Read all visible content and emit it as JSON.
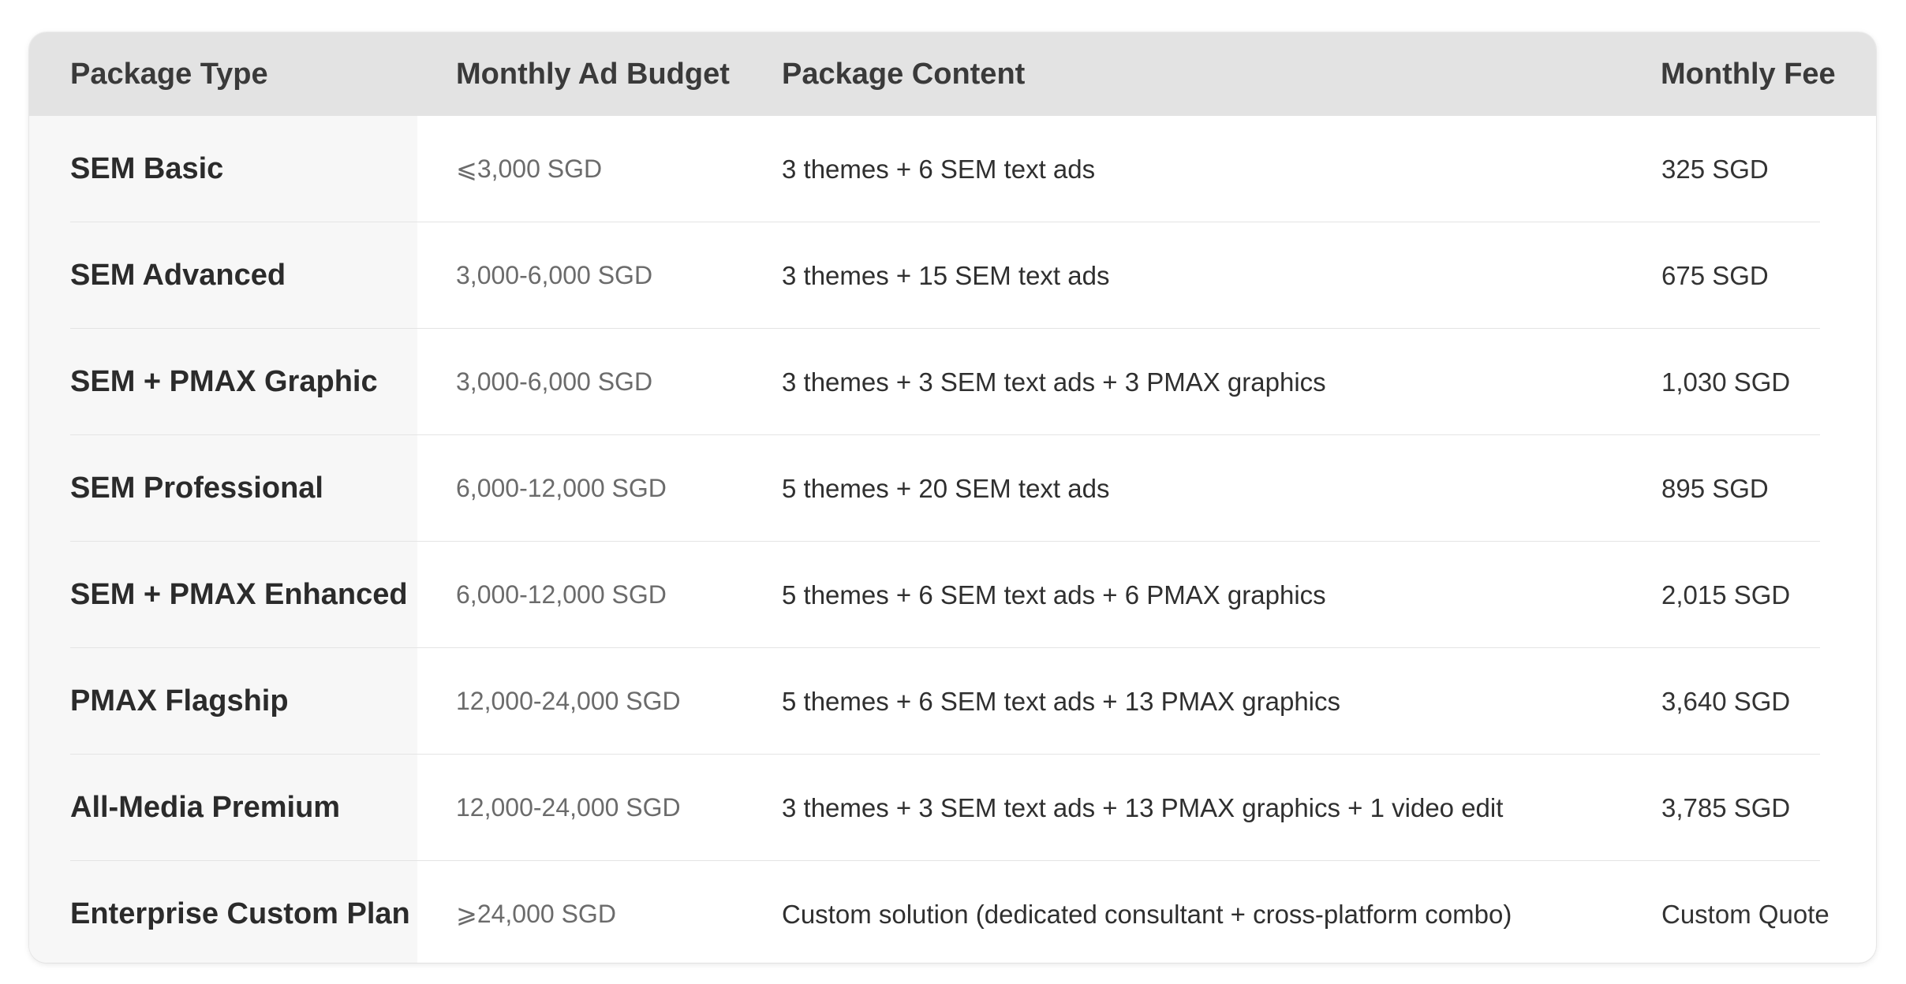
{
  "table": {
    "headers": {
      "package_type": "Package Type",
      "monthly_ad_budget": "Monthly Ad Budget",
      "package_content": "Package Content",
      "monthly_fee": "Monthly Fee"
    },
    "rows": [
      {
        "type": "SEM Basic",
        "budget": "⩽3,000 SGD",
        "content": "3 themes + 6 SEM text ads",
        "fee": "325 SGD"
      },
      {
        "type": "SEM Advanced",
        "budget": "3,000-6,000 SGD",
        "content": "3 themes + 15 SEM text ads",
        "fee": "675 SGD"
      },
      {
        "type": "SEM + PMAX Graphic",
        "budget": "3,000-6,000 SGD",
        "content": "3 themes + 3 SEM text ads + 3 PMAX graphics",
        "fee": "1,030 SGD"
      },
      {
        "type": "SEM Professional",
        "budget": "6,000-12,000 SGD",
        "content": "5 themes + 20 SEM text ads",
        "fee": "895 SGD"
      },
      {
        "type": "SEM + PMAX Enhanced",
        "budget": "6,000-12,000 SGD",
        "content": "5 themes + 6 SEM text ads + 6 PMAX graphics",
        "fee": "2,015 SGD"
      },
      {
        "type": "PMAX Flagship",
        "budget": "12,000-24,000 SGD",
        "content": "5 themes + 6 SEM text ads + 13 PMAX graphics",
        "fee": "3,640 SGD"
      },
      {
        "type": "All-Media Premium",
        "budget": "12,000-24,000 SGD",
        "content": "3 themes + 3 SEM text ads + 13 PMAX graphics + 1 video edit",
        "fee": "3,785 SGD"
      },
      {
        "type": "Enterprise Custom Plan",
        "budget": "⩾24,000 SGD",
        "content": "Custom solution (dedicated consultant + cross-platform combo)",
        "fee": "Custom Quote"
      }
    ]
  },
  "colors": {
    "header_bg": "#e3e3e3",
    "first_col_bg": "#f7f7f7",
    "divider": "#e4e4e4",
    "text_primary": "#2b2b2b",
    "text_muted": "#6b6b6b"
  }
}
